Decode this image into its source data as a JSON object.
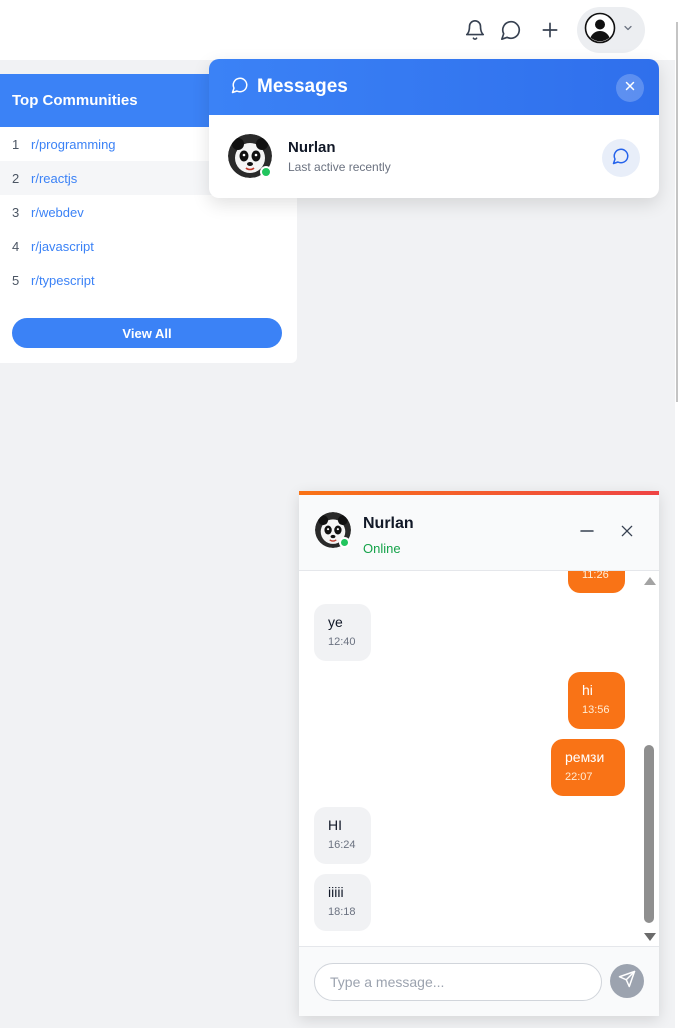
{
  "colors": {
    "primary_blue": "#3b82f6",
    "chat_orange": "#f97316",
    "online_green": "#22c55e",
    "status_text_green": "#16a34a"
  },
  "topbar": {
    "icons": [
      "bell-icon",
      "chat-bubble-icon",
      "plus-icon",
      "user-avatar-icon",
      "chevron-down-icon"
    ]
  },
  "communities": {
    "title": "Top Communities",
    "items": [
      {
        "rank": "1",
        "name": "r/programming"
      },
      {
        "rank": "2",
        "name": "r/reactjs"
      },
      {
        "rank": "3",
        "name": "r/webdev"
      },
      {
        "rank": "4",
        "name": "r/javascript"
      },
      {
        "rank": "5",
        "name": "r/typescript"
      }
    ],
    "view_all_label": "View All"
  },
  "messages_panel": {
    "title": "Messages",
    "conversations": [
      {
        "name": "Nurlan",
        "subtitle": "Last active recently",
        "online": true,
        "avatar": "panda-avatar"
      }
    ]
  },
  "chat": {
    "contact_name": "Nurlan",
    "status": "Online",
    "messages": [
      {
        "direction": "out",
        "text": "",
        "time": "11:26"
      },
      {
        "direction": "in",
        "text": "ye",
        "time": "12:40"
      },
      {
        "direction": "out",
        "text": "hi",
        "time": "13:56"
      },
      {
        "direction": "out",
        "text": "ремзи",
        "time": "22:07"
      },
      {
        "direction": "in",
        "text": "HI",
        "time": "16:24"
      },
      {
        "direction": "in",
        "text": "iiiii",
        "time": "18:18"
      }
    ],
    "input_placeholder": "Type a message..."
  }
}
